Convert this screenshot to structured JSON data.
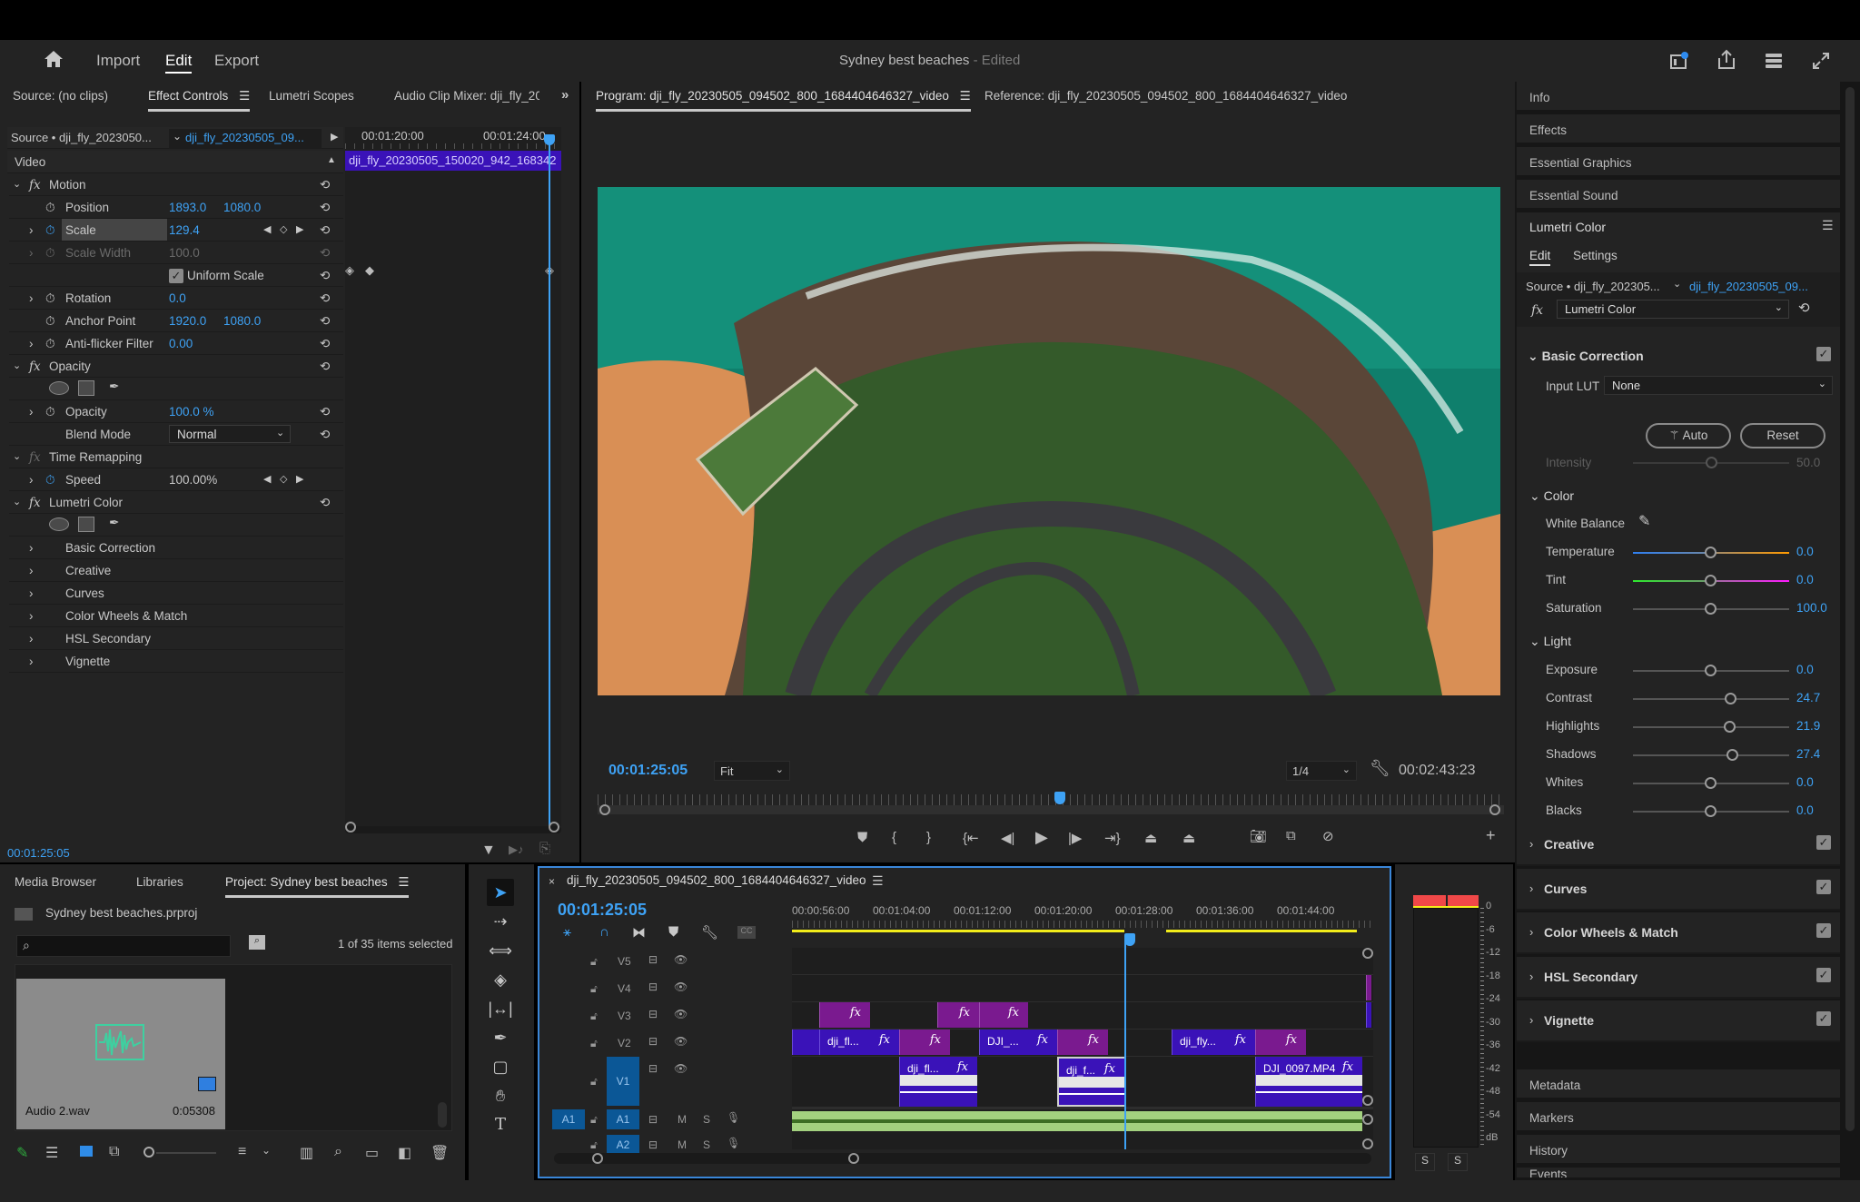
{
  "header": {
    "nav": [
      "Import",
      "Edit",
      "Export"
    ],
    "active_nav": "Edit",
    "project_title": "Sydney best beaches",
    "project_status": "- Edited"
  },
  "left_tabs": [
    "Source: (no clips)",
    "Effect Controls",
    "Lumetri Scopes",
    "Audio Clip Mixer: dji_fly_20"
  ],
  "effect_controls": {
    "source_label": "Source • dji_fly_2023050...",
    "clip_label": "dji_fly_20230505_09...",
    "ruler": [
      "00:01:20:00",
      "00:01:24:00"
    ],
    "mini_clip": "dji_fly_20230505_150020_942_168342",
    "video_label": "Video",
    "motion": "Motion",
    "position_label": "Position",
    "position_x": "1893.0",
    "position_y": "1080.0",
    "scale_label": "Scale",
    "scale": "129.4",
    "scale_width_label": "Scale Width",
    "scale_width": "100.0",
    "uniform_scale": "Uniform Scale",
    "rotation_label": "Rotation",
    "rotation": "0.0",
    "anchor_label": "Anchor Point",
    "anchor_x": "1920.0",
    "anchor_y": "1080.0",
    "antiflicker_label": "Anti-flicker Filter",
    "antiflicker": "0.00",
    "opacity_section": "Opacity",
    "opacity_label": "Opacity",
    "opacity": "100.0 %",
    "blend_label": "Blend Mode",
    "blend": "Normal",
    "time_remap": "Time Remapping",
    "speed_label": "Speed",
    "speed": "100.00%",
    "lumetri": "Lumetri Color",
    "lumetri_items": [
      "Basic Correction",
      "Creative",
      "Curves",
      "Color Wheels & Match",
      "HSL Secondary",
      "Vignette"
    ],
    "timecode": "00:01:25:05"
  },
  "program": {
    "tab": "Program: dji_fly_20230505_094502_800_1684404646327_video",
    "ref_tab": "Reference: dji_fly_20230505_094502_800_1684404646327_video",
    "timecode": "00:01:25:05",
    "fit": "Fit",
    "resolution": "1/4",
    "duration": "00:02:43:23",
    "playhead_fraction": 0.51
  },
  "right_panel": {
    "items_top": [
      "Info",
      "Effects",
      "Essential Graphics",
      "Essential Sound"
    ],
    "lumetri_title": "Lumetri Color",
    "tabs": [
      "Edit",
      "Settings"
    ],
    "source_label": "Source • dji_fly_202305...",
    "clip_label": "dji_fly_20230505_09...",
    "effect_select": "Lumetri Color",
    "basic_correction": "Basic Correction",
    "input_lut_label": "Input LUT",
    "input_lut": "None",
    "auto": "Auto",
    "reset": "Reset",
    "intensity_label": "Intensity",
    "intensity": "50.0",
    "color_section": "Color",
    "white_balance": "White Balance",
    "color_sliders": [
      {
        "label": "Temperature",
        "value": "0.0",
        "pos": 0.5
      },
      {
        "label": "Tint",
        "value": "0.0",
        "pos": 0.5
      },
      {
        "label": "Saturation",
        "value": "100.0",
        "pos": 0.5
      }
    ],
    "light_section": "Light",
    "light_sliders": [
      {
        "label": "Exposure",
        "value": "0.0",
        "pos": 0.5
      },
      {
        "label": "Contrast",
        "value": "24.7",
        "pos": 0.63
      },
      {
        "label": "Highlights",
        "value": "21.9",
        "pos": 0.62
      },
      {
        "label": "Shadows",
        "value": "27.4",
        "pos": 0.64
      },
      {
        "label": "Whites",
        "value": "0.0",
        "pos": 0.5
      },
      {
        "label": "Blacks",
        "value": "0.0",
        "pos": 0.5
      }
    ],
    "sections": [
      "Creative",
      "Curves",
      "Color Wheels & Match",
      "HSL Secondary",
      "Vignette"
    ],
    "items_bottom": [
      "Metadata",
      "Markers",
      "History",
      "Events"
    ]
  },
  "project": {
    "tabs": [
      "Media Browser",
      "Libraries",
      "Project: Sydney best beaches"
    ],
    "file": "Sydney best beaches.prproj",
    "search_placeholder": "",
    "selection": "1 of 35 items selected",
    "item_name": "Audio 2.wav",
    "item_duration": "0:05308"
  },
  "timeline": {
    "title": "dji_fly_20230505_094502_800_1684404646327_video",
    "timecode": "00:01:25:05",
    "ruler": [
      "00:00:56:00",
      "00:01:04:00",
      "00:01:12:00",
      "00:01:20:00",
      "00:01:28:00",
      "00:01:36:00",
      "00:01:44:00"
    ],
    "video_tracks": [
      "V5",
      "V4",
      "V3",
      "V2",
      "V1"
    ],
    "audio_tracks": [
      "A1",
      "A2"
    ],
    "source_patch": "A1",
    "track_buttons": {
      "mute": "M",
      "solo": "S"
    },
    "clips": {
      "v2_1": "dji_fl...",
      "v2_2": "DJI_...",
      "v2_3": "dji_fly...",
      "v1_1": "dji_fl...",
      "v1_2": "dji_f...",
      "v1_3": "DJI_0097.MP4",
      "fx": "fx"
    }
  },
  "meters": {
    "scale": [
      "0",
      "-6",
      "-12",
      "-18",
      "-24",
      "-30",
      "-36",
      "-42",
      "-48",
      "-54",
      "dB"
    ],
    "solo": [
      "S",
      "S"
    ]
  },
  "colors": {
    "accent": "#3ea2f5",
    "clip_purple": "#7a1a8f",
    "clip_indigo": "#3a12b8",
    "audio_green": "#a3d17f",
    "peak_red": "#f04848",
    "work_area": "#f2ec1a"
  }
}
